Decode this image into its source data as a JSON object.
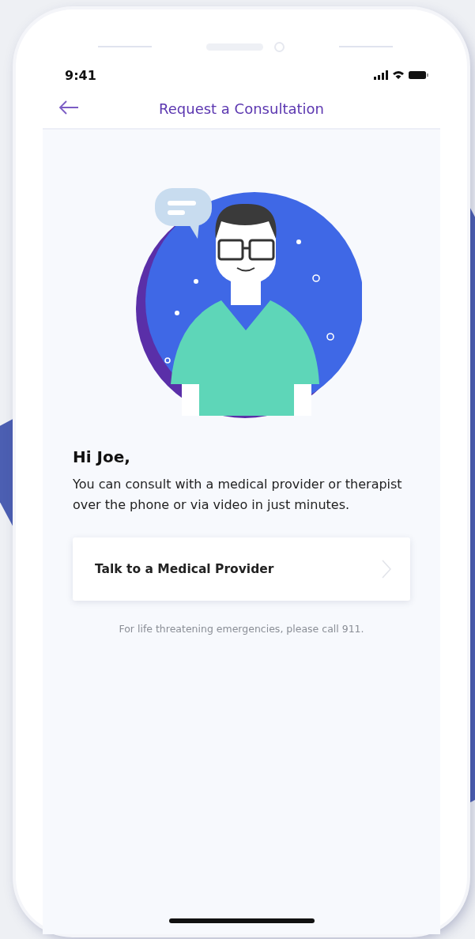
{
  "status_bar": {
    "time": "9:41"
  },
  "header": {
    "title": "Request a Consultation"
  },
  "greeting": "Hi Joe,",
  "message": "You can consult with a medical provider or therapist over the phone or via video in just minutes.",
  "action": {
    "label": "Talk to a Medical Provider"
  },
  "note": "For life threatening emergencies, please call 911."
}
